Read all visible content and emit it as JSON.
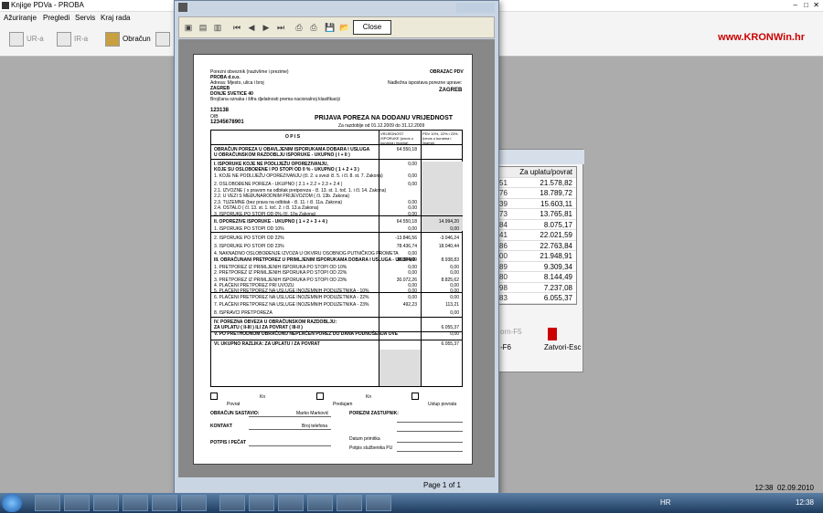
{
  "app": {
    "title": "Knjige PDVa - PROBA",
    "brand": "www.KRONWin.hr"
  },
  "menu": [
    "Ažuriranje",
    "Pregledi",
    "Servis",
    "Kraj rada"
  ],
  "toolbar": {
    "ura": "UR-a",
    "ira": "IR-a",
    "obracun": "Obračun"
  },
  "bg_table": {
    "header": "Za uplatu/povrat",
    "rows": [
      [
        "51",
        "21.578,82"
      ],
      [
        "76",
        "18.789,72"
      ],
      [
        "39",
        "15.603,11"
      ],
      [
        "73",
        "13.765,81"
      ],
      [
        "84",
        "8.075,17"
      ],
      [
        "41",
        "22.021,59"
      ],
      [
        "86",
        "22.763,84"
      ],
      [
        "00",
        "21.948,91"
      ],
      [
        "89",
        "9.309,34"
      ],
      [
        "80",
        "8.144,49"
      ],
      [
        "98",
        "7.237,08"
      ],
      [
        "83",
        "6.055,37"
      ]
    ],
    "btn1": "-F6",
    "btn2": "Zatvori-Esc",
    "btn3": "orn-F5"
  },
  "preview": {
    "close": "Close",
    "page": "Page 1 of 1"
  },
  "form": {
    "obveznik_label": "Porezni obveznik (naziv/ime i prezime)",
    "obveznik": "PROBA d.o.o.",
    "adresa_label": "Adresa: Mjesto, ulica i broj",
    "mjesto": "ZAGREB",
    "ulica": "DONJE SVETICE 40",
    "sifra_label": "Brojčana oznaka i šifra djelatnosti prema nacionalnoj klasifikaciji",
    "sifra": "123138",
    "oib_label": "OIB",
    "oib": "12345678901",
    "obrazac": "OBRAZAC PDV",
    "ispostava_label": "Nadležna ispostava porezne uprave:",
    "ispostava": "ZAGREB",
    "title": "PRIJAVA POREZA NA DODANU VRIJEDNOST",
    "razdoblje": "Za razdoblje od 01.12.2009 do 31.12.2009",
    "opis": "O P I S",
    "col1": "VRIJEDNOST ISPORUKE (iznos u kunama i lipama)",
    "col2": "PDV 10%, 22% i 23% (iznos u kunama i lipama)",
    "rows": [
      {
        "t": "OBRAČUN POREZA U OBAVLJENIM ISPORUKAMA DOBARA I USLUGA",
        "v1": "64.550,18",
        "v2": ""
      },
      {
        "t": "U OBRAČUNSKOM RAZDOBLJU ISPORUKE - UKUPNO ( I + II )",
        "v1": "",
        "v2": ""
      },
      {
        "t": "I. ISPORUKE KOJE NE PODLIJEŽU OPOREZIVANJU,",
        "v1": "0,00",
        "v2": ""
      },
      {
        "t": "KOJE SU OSLOBOĐENE I PO STOPI OD 0 % - UKUPNO ( 1 + 2 + 3 )",
        "v1": "",
        "v2": ""
      },
      {
        "t": "1. KOJE NE PODLIJEŽU OPOREZIVANJU (čl. 2. u svezi čl. 5. i čl. 8. st. 7. Zakona)",
        "v1": "0,00",
        "v2": ""
      },
      {
        "t": "2. OSLOBOĐENE POREZA - UKUPNO ( 2.1 + 2.2 + 2.3 + 2.4 )",
        "v1": "0,00",
        "v2": ""
      },
      {
        "t": "2.1. IZVOZNE ( s pravom na odbitak pretporeza - čl. 13. st. 1. toč. 1. i čl. 14. Zakona)",
        "v1": "",
        "v2": ""
      },
      {
        "t": "2.2. U VEZI S MEĐUNARODNIM PRIJEVOZOM ( čl. 13b. Zakona)",
        "v1": "",
        "v2": ""
      },
      {
        "t": "2.3. TUZEMNE (bez prava na odbitak - čl. 11. i čl. 11a. Zakona)",
        "v1": "0,00",
        "v2": ""
      },
      {
        "t": "2.4. OSTALO ( čl. 13. st. 1. toč. 2. i čl. 13.a Zakona)",
        "v1": "0,00",
        "v2": ""
      },
      {
        "t": "3. ISPORUKE PO STOPI OD 0% (čl. 10a Zakona)",
        "v1": "0,00",
        "v2": ""
      },
      {
        "t": "II. OPOREZIVE ISPORUKE - UKUPNO ( 1 + 2 + 3 + 4 )",
        "v1": "64.550,18",
        "v2": "14.994,20"
      },
      {
        "t": "1. ISPORUKE PO STOPI OD 10%",
        "v1": "0,00",
        "v2": "0,00"
      },
      {
        "t": "2. ISPORUKE PO STOPI OD 22%",
        "v1": "-13.846,56",
        "v2": "-3.046,24"
      },
      {
        "t": "3. ISPORUKE PO STOPI OD 23%",
        "v1": "78.436,74",
        "v2": "18.040,44"
      },
      {
        "t": "4. NAKNADNO OSLOBOĐENJE IZVOZA U OKVIRU OSOBNOG PUTNIČKOG PROMETA",
        "v1": "0,00",
        "v2": ""
      },
      {
        "t": "III. OBRAČUNANI PRETPOREZ U PRIMLJENIM ISPORUKAMA DOBARA I USLUGA - UKUPNO",
        "v1": "30.564,49",
        "v2": "8.938,83"
      },
      {
        "t": "1. PRETPOREZ IZ PRIMLJENIH ISPORUKA PO STOPI OD 10%",
        "v1": "0,00",
        "v2": "0,00"
      },
      {
        "t": "2. PRETPOREZ IZ PRIMLJENIH ISPORUKA PO STOPI OD 22%",
        "v1": "0,00",
        "v2": "0,00"
      },
      {
        "t": "3. PRETPOREZ IZ PRIMLJENIH ISPORUKA PO STOPI OD 23%",
        "v1": "30.072,26",
        "v2": "8.825,62"
      },
      {
        "t": "4. PLAĆENI PRETPOREZ PRI UVOZU",
        "v1": "0,00",
        "v2": "0,00"
      },
      {
        "t": "5. PLAĆENI PRETPOREZ NA USLUGE INOZEMNIH PODUZETNIKA - 10%",
        "v1": "0,00",
        "v2": "0,00"
      },
      {
        "t": "6. PLAĆENI PRETPOREZ NA USLUGE INOZEMNIH PODUZETNIKA - 22%",
        "v1": "0,00",
        "v2": "0,00"
      },
      {
        "t": "7. PLAĆENI PRETPOREZ NA USLUGE INOZEMNIH PODUZETNIKA - 23%",
        "v1": "492,23",
        "v2": "113,21"
      },
      {
        "t": "8. ISPRAVCI PRETPOREZA",
        "v1": "",
        "v2": "0,00"
      },
      {
        "t": "IV. POREZNA OBVEZA U OBRAČUNSKOM RAZDOBLJU:",
        "v1": "",
        "v2": ""
      },
      {
        "t": "ZA UPLATU ( II-III ) ILI ZA POVRAT ( III-II )",
        "v1": "",
        "v2": "6.055,37"
      },
      {
        "t": "V. PO PRETHODNOM OBRAČUNU NEPLAĆEN POREZ DO DANA PODNOŠENJA OVE",
        "v1": "",
        "v2": "0,00"
      },
      {
        "t": "VI. UKUPNO RAZLIKA:   ZA UPLATU   /   ZA POVRAT",
        "v1": "",
        "v2": "6.055,37"
      }
    ],
    "povrat": "Povrat",
    "predujam": "Predujam",
    "uplata": "Ustup povrata",
    "kn": "Kn",
    "sast_label": "OBRAČUN SASTAVIO:",
    "kontakt_label": "KONTAKT",
    "potpis_label": "POTPIS I PEČAT",
    "prezime": "Marko Marković",
    "email": "Broj telefona",
    "preuzeo": "POREZNI ZASTUPNIK:",
    "datum_label": "Datum primitka",
    "potpis2": "Potpis službenika PU"
  },
  "status": {
    "time": "12:38",
    "date": "02.09.2010"
  },
  "taskbar": {
    "lang": "HR",
    "time": "12:38"
  }
}
